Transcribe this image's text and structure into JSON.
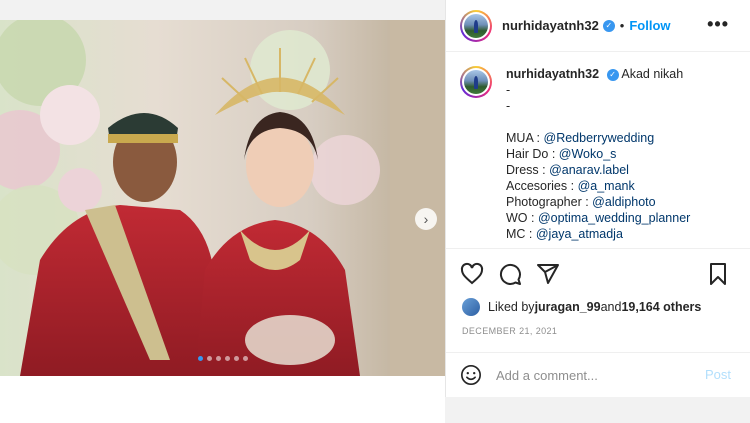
{
  "post": {
    "username": "nurhidayatnh32",
    "separator": "•",
    "follow_label": "Follow",
    "more_label": "•••",
    "verified_mark": "✓",
    "image_alt": "Couple in traditional red wedding attire",
    "carousel": {
      "dot_count": 6,
      "active_index": 0
    },
    "next_glyph": "›"
  },
  "caption": {
    "username": "nurhidayatnh32",
    "title": "Akad nikah",
    "dash1": "-",
    "dash2": "-",
    "lines": [
      {
        "label": "MUA : ",
        "handle": "@Redberrywedding"
      },
      {
        "label": "Hair Do : ",
        "handle": "@Woko_s"
      },
      {
        "label": "Dress : ",
        "handle": "@anarav.label"
      },
      {
        "label": "Accesories : ",
        "handle": "@a_mank"
      },
      {
        "label": "Photographer : ",
        "handle": "@aldiphoto"
      },
      {
        "label": "WO : ",
        "handle": "@optima_wedding_planner"
      },
      {
        "label": "MC : ",
        "handle": "@jaya_atmadja"
      }
    ]
  },
  "actions": {
    "icons": [
      "heart-icon",
      "comment-icon",
      "share-icon",
      "bookmark-icon"
    ]
  },
  "likes": {
    "prefix": "Liked by ",
    "liker": "juragan_99",
    "middle": " and ",
    "others": "19,164 others"
  },
  "date": "DECEMBER 21, 2021",
  "comment": {
    "placeholder": "Add a comment...",
    "post_label": "Post"
  },
  "colors": {
    "accent": "#0095f6",
    "link": "#00376b",
    "muted": "#8e8e8e",
    "post_disabled": "#b2dffc"
  }
}
